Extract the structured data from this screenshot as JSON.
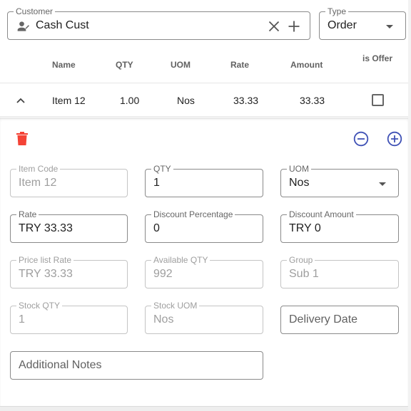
{
  "customer": {
    "label": "Customer",
    "value": "Cash Cust"
  },
  "type": {
    "label": "Type",
    "value": "Order"
  },
  "table": {
    "headers": {
      "name": "Name",
      "qty": "QTY",
      "uom": "UOM",
      "rate": "Rate",
      "amount": "Amount",
      "is_offer": "is Offer"
    },
    "row": {
      "name": "Item 12",
      "qty": "1.00",
      "uom": "Nos",
      "rate": "33.33",
      "amount": "33.33",
      "is_offer": false
    }
  },
  "details": {
    "item_code": {
      "label": "Item Code",
      "value": "Item 12"
    },
    "qty": {
      "label": "QTY",
      "value": "1"
    },
    "uom": {
      "label": "UOM",
      "value": "Nos"
    },
    "rate": {
      "label": "Rate",
      "value": "TRY 33.33"
    },
    "discount_percentage": {
      "label": "Discount Percentage",
      "value": "0"
    },
    "discount_amount": {
      "label": "Discount Amount",
      "value": "TRY 0"
    },
    "price_list_rate": {
      "label": "Price list Rate",
      "value": "TRY 33.33"
    },
    "available_qty": {
      "label": "Available QTY",
      "value": "992"
    },
    "group": {
      "label": "Group",
      "value": "Sub 1"
    },
    "stock_qty": {
      "label": "Stock QTY",
      "value": "1"
    },
    "stock_uom": {
      "label": "Stock UOM",
      "value": "Nos"
    },
    "delivery_date": {
      "placeholder": "Delivery Date"
    },
    "additional_notes": {
      "placeholder": "Additional Notes"
    }
  },
  "icons": {
    "customer": "account-edit-icon",
    "clear": "close-icon",
    "add": "plus-icon",
    "collapse": "chevron-up-icon",
    "delete": "trash-icon",
    "decrement": "minus-circle-icon",
    "increment": "plus-circle-icon"
  },
  "colors": {
    "delete": "#f44336",
    "stepper": "#3f51b5",
    "border": "#8a8a8a"
  }
}
